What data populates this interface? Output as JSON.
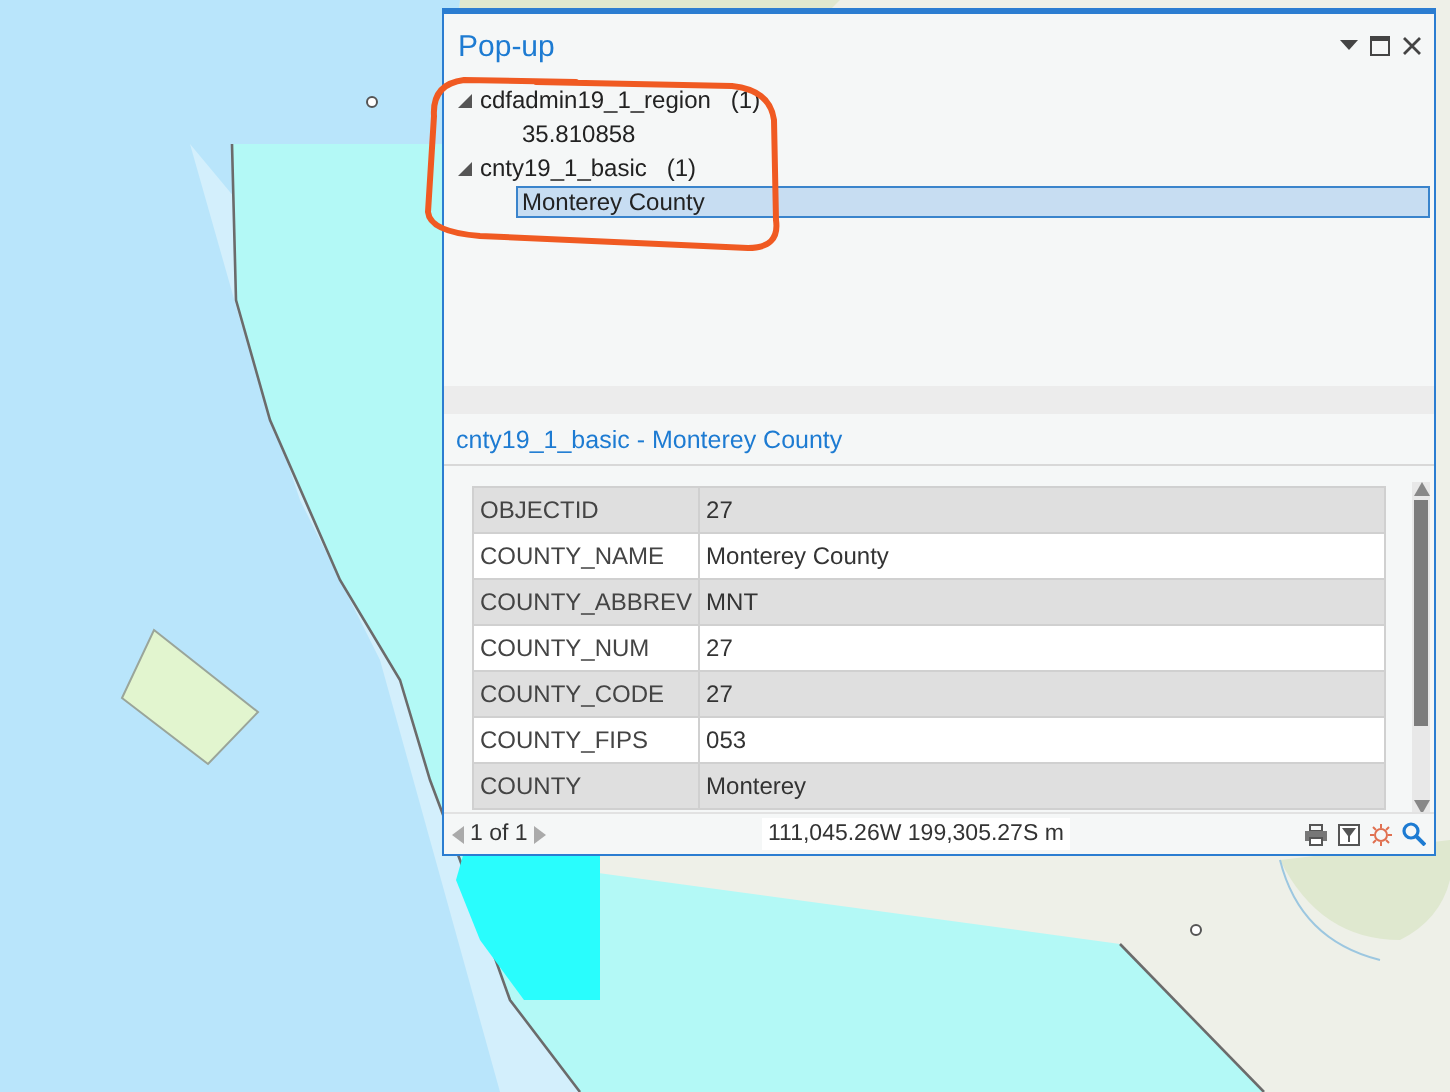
{
  "popup": {
    "title": "Pop-up",
    "tree": [
      {
        "label": "cdfadmin19_1_region",
        "count": "(1)",
        "expanded": true,
        "children": [
          {
            "label": "35.810858",
            "selected": false
          }
        ]
      },
      {
        "label": "cnty19_1_basic",
        "count": "(1)",
        "expanded": true,
        "children": [
          {
            "label": "Monterey County",
            "selected": true
          }
        ]
      }
    ],
    "detail_title": "cnty19_1_basic - Monterey County",
    "fields": [
      {
        "name": "OBJECTID",
        "value": "27"
      },
      {
        "name": "COUNTY_NAME",
        "value": "Monterey County"
      },
      {
        "name": "COUNTY_ABBREV",
        "value": "MNT"
      },
      {
        "name": "COUNTY_NUM",
        "value": "27"
      },
      {
        "name": "COUNTY_CODE",
        "value": "27"
      },
      {
        "name": "COUNTY_FIPS",
        "value": "053"
      },
      {
        "name": "COUNTY",
        "value": "Monterey"
      }
    ],
    "footer": {
      "page": "1 of 1",
      "coordinates": "111,045.26W 199,305.27S m"
    }
  }
}
